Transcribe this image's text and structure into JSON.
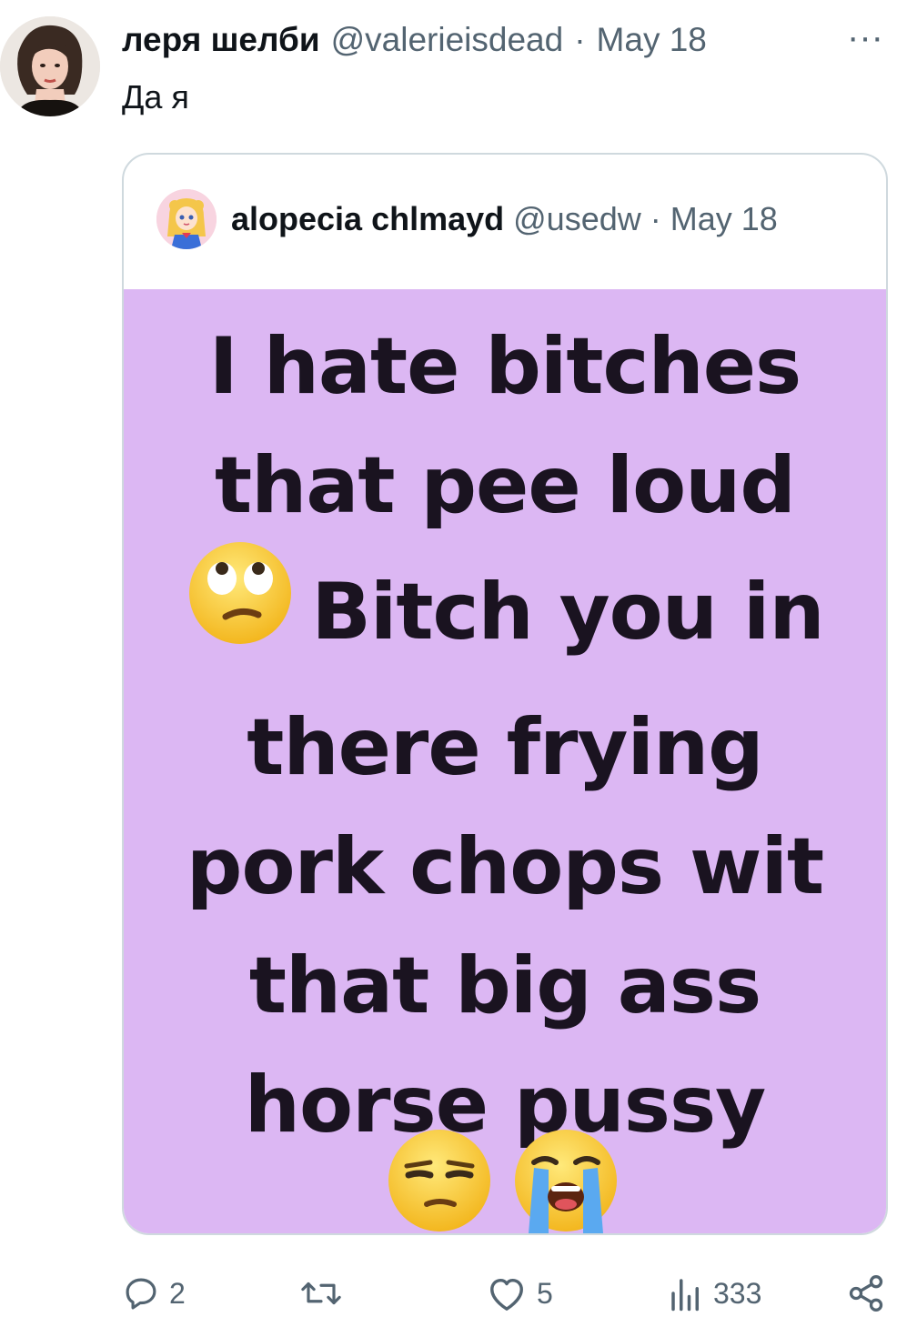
{
  "tweet": {
    "display_name": "леря шелби",
    "handle": "@valerieisdead",
    "separator": "·",
    "date": "May 18",
    "more_label": "···",
    "text": "Да я"
  },
  "quoted": {
    "display_name": "alopecia chlmayd",
    "handle": "@usedw",
    "separator": "·",
    "date": "May 18",
    "meme_lines": [
      "I hate bitches",
      "that pee loud",
      "Bitch you in",
      "there frying",
      "pork chops wit",
      "that big ass",
      "horse pussy"
    ],
    "meme_background": "#dcb7f3"
  },
  "actions": {
    "reply_count": "2",
    "retweet_count": "",
    "like_count": "5",
    "views_count": "333"
  },
  "icons": {
    "reply": "reply-icon",
    "retweet": "retweet-icon",
    "like": "heart-icon",
    "views": "views-icon",
    "share": "share-icon"
  }
}
